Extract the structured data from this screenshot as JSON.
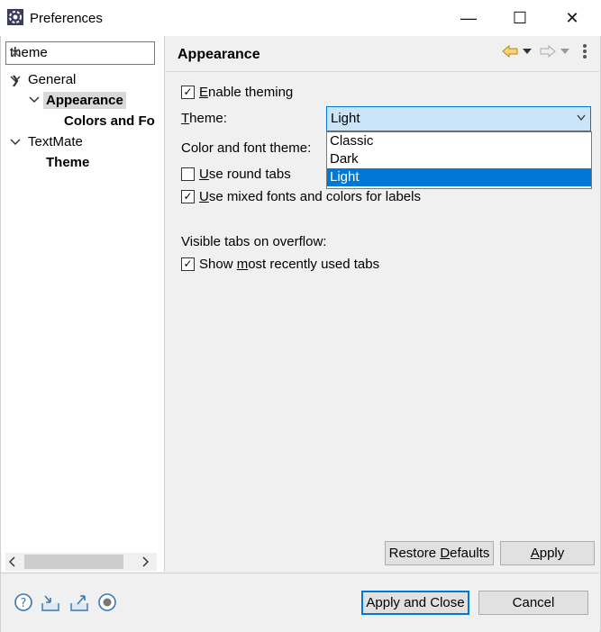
{
  "window": {
    "title": "Preferences",
    "minimize_label": "—",
    "maximize_label": "☐",
    "close_label": "✕"
  },
  "filter": {
    "value": "theme",
    "clear_label": "✕"
  },
  "tree": {
    "items": [
      {
        "label": "General"
      },
      {
        "label": "Appearance"
      },
      {
        "label": "Colors and Fo"
      },
      {
        "label": "TextMate"
      },
      {
        "label": "Theme"
      }
    ]
  },
  "page": {
    "title": "Appearance",
    "enable_theming": {
      "label_prefix": "",
      "accel": "E",
      "label_rest": "nable theming",
      "checked": true
    },
    "theme": {
      "accel": "T",
      "label_rest": "heme:",
      "selected": "Light",
      "options": [
        "Classic",
        "Dark",
        "Light"
      ]
    },
    "color_font_theme": {
      "label": "Color and font theme:"
    },
    "round_tabs": {
      "accel": "U",
      "label_rest": "se round tabs",
      "checked": false
    },
    "mixed_fonts": {
      "accel": "U",
      "label_rest": "se mixed fonts and colors for labels",
      "checked": true
    },
    "visible_tabs": {
      "label": "Visible tabs on overflow:"
    },
    "mru_tabs": {
      "label_prefix": "Show ",
      "accel": "m",
      "label_rest": "ost recently used tabs",
      "checked": true
    }
  },
  "buttons": {
    "restore_prefix": "Restore ",
    "restore_accel": "D",
    "restore_rest": "efaults",
    "apply_accel": "A",
    "apply_rest": "pply",
    "apply_close": "Apply and Close",
    "cancel": "Cancel"
  },
  "icons": [
    "help-icon",
    "import-icon",
    "export-icon",
    "record-icon"
  ]
}
